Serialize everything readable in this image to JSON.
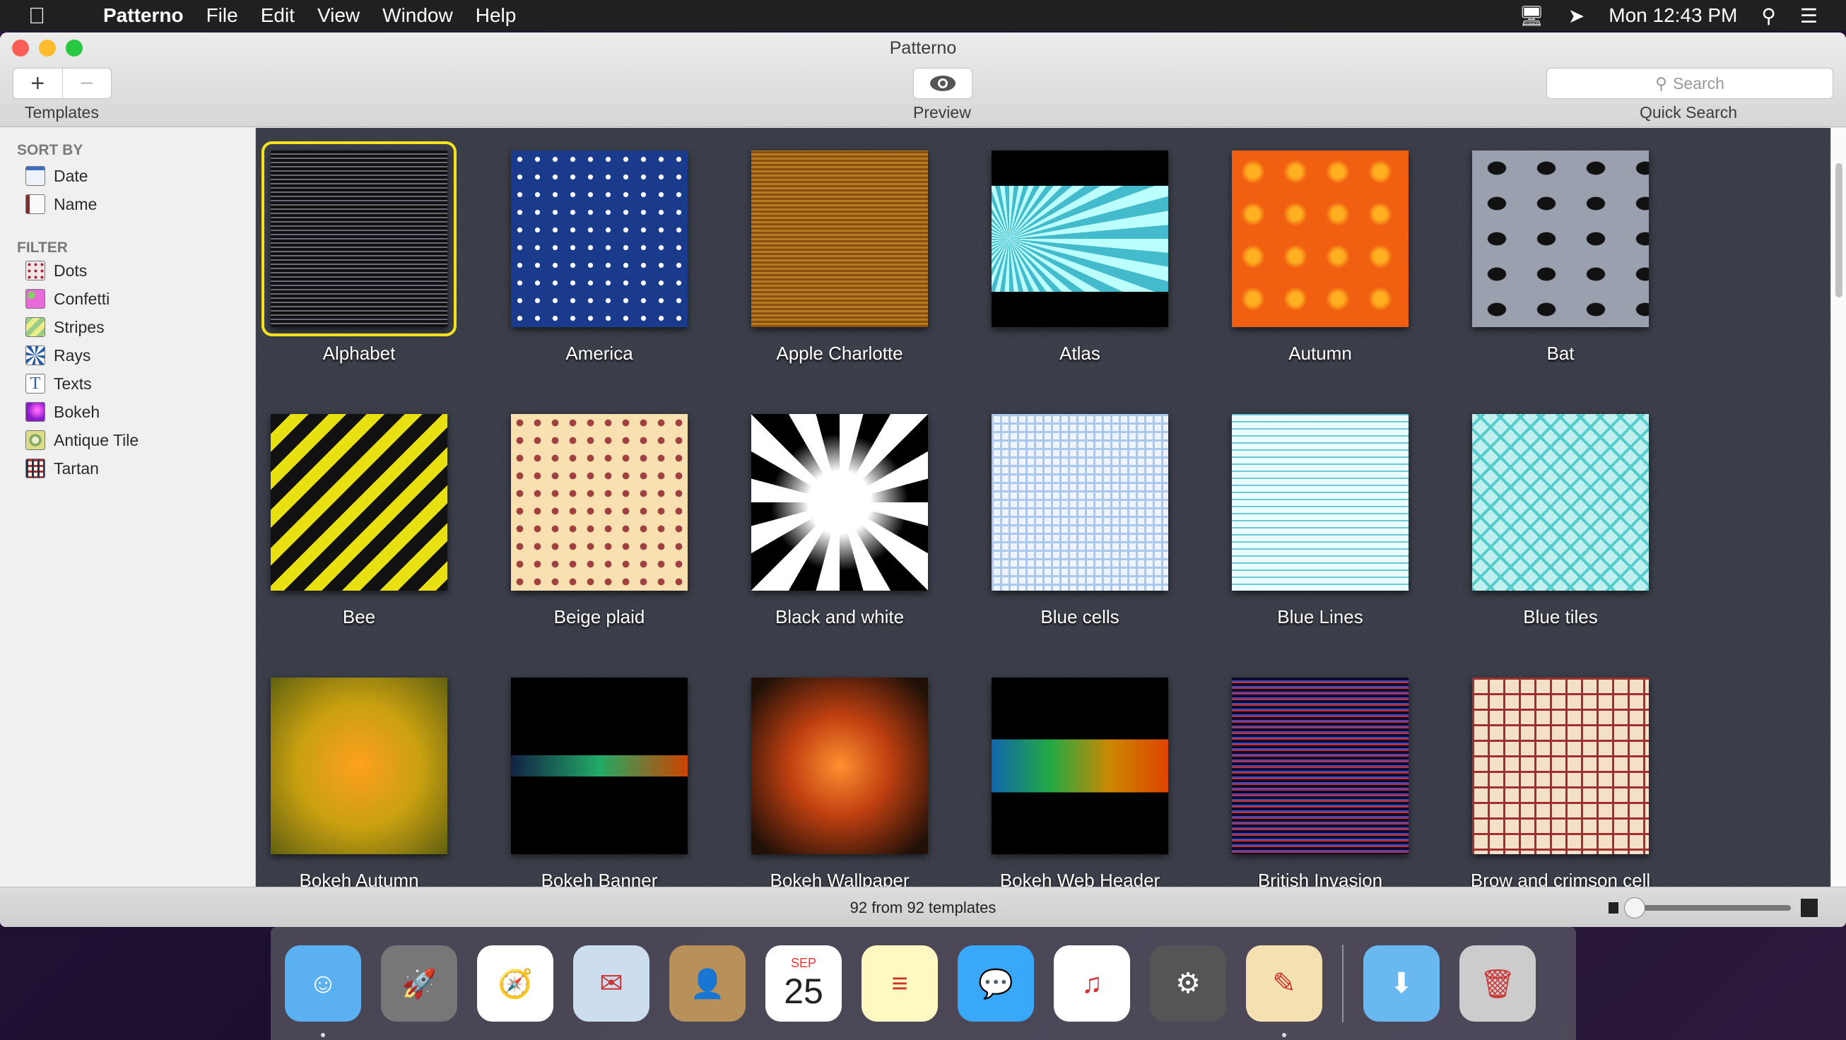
{
  "menubar": {
    "app": "Patterno",
    "items": [
      "File",
      "Edit",
      "View",
      "Window",
      "Help"
    ],
    "clock": "Mon 12:43 PM"
  },
  "window": {
    "title": "Patterno"
  },
  "toolbar": {
    "add": "+",
    "remove": "−",
    "templates_label": "Templates",
    "preview_label": "Preview",
    "search_placeholder": "Search",
    "search_label": "Quick Search"
  },
  "sidebar": {
    "sort_heading": "SORT BY",
    "sort": [
      {
        "label": "Date",
        "icon": "calendar-icon"
      },
      {
        "label": "Name",
        "icon": "name-book-icon"
      }
    ],
    "filter_heading": "FILTER",
    "filters": [
      {
        "label": "Dots",
        "icon": "dots-icon"
      },
      {
        "label": "Confetti",
        "icon": "confetti-icon"
      },
      {
        "label": "Stripes",
        "icon": "stripes-icon"
      },
      {
        "label": "Rays",
        "icon": "rays-icon"
      },
      {
        "label": "Texts",
        "icon": "texts-icon"
      },
      {
        "label": "Bokeh",
        "icon": "bokeh-icon"
      },
      {
        "label": "Antique Tile",
        "icon": "antique-tile-icon"
      },
      {
        "label": "Tartan",
        "icon": "tartan-icon"
      }
    ]
  },
  "templates": [
    {
      "name": "Alphabet",
      "selected": true
    },
    {
      "name": "America"
    },
    {
      "name": "Apple Charlotte"
    },
    {
      "name": "Atlas"
    },
    {
      "name": "Autumn"
    },
    {
      "name": "Bat"
    },
    {
      "name": "Bee"
    },
    {
      "name": "Beige plaid"
    },
    {
      "name": "Black and white"
    },
    {
      "name": "Blue cells"
    },
    {
      "name": "Blue Lines"
    },
    {
      "name": "Blue tiles"
    },
    {
      "name": "Bokeh Autumn"
    },
    {
      "name": "Bokeh Banner"
    },
    {
      "name": "Bokeh Wallpaper"
    },
    {
      "name": "Bokeh Web Header"
    },
    {
      "name": "British Invasion"
    },
    {
      "name": "Brow and crimson cell"
    }
  ],
  "status": {
    "text": "92 from 92 templates",
    "zoom_fraction": 0.0
  },
  "dock": [
    "Finder",
    "Launchpad",
    "Safari",
    "Mail",
    "Contacts",
    "Calendar",
    "Notes",
    "Messages",
    "iTunes",
    "System Preferences",
    "Patterno",
    "Downloads",
    "Trash"
  ],
  "calendar": {
    "month": "SEP",
    "day": "25"
  },
  "colors": {
    "selection": "#f6e21c",
    "close": "#fc5f57",
    "minimize": "#fdbc2e",
    "zoom": "#28c840"
  }
}
